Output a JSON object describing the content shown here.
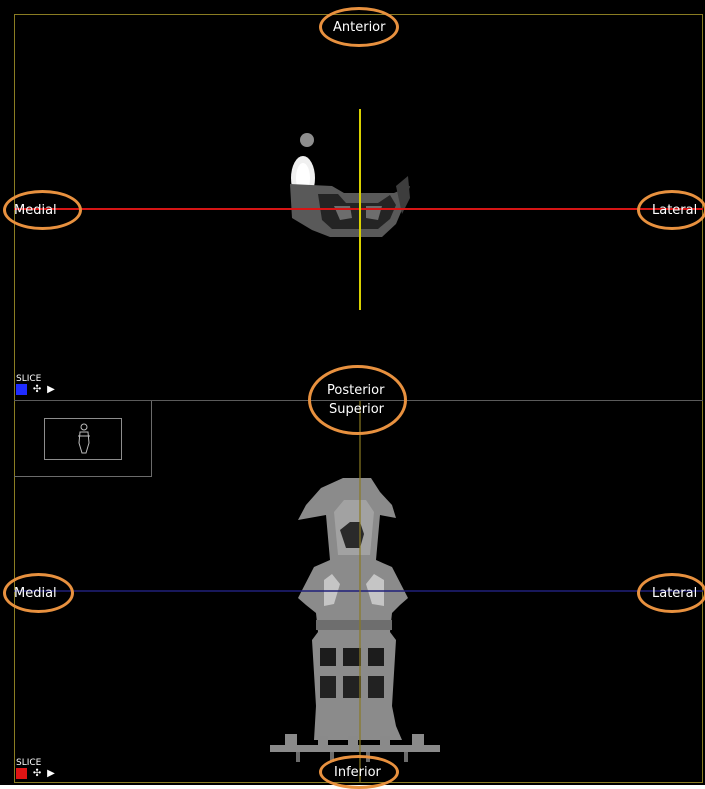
{
  "views": {
    "axial": {
      "top_label": "Anterior",
      "bottom_label": "Posterior",
      "left_label": "Medial",
      "right_label": "Lateral",
      "slice_text": "SLICE",
      "slice_color": "#1f2cff",
      "horizontal_line_color": "#d61515",
      "vertical_line_color": "#d9d100"
    },
    "coronal": {
      "top_label": "Superior",
      "bottom_label": "Inferior",
      "left_label": "Medial",
      "right_label": "Lateral",
      "slice_text": "SLICE",
      "slice_color": "#e01414",
      "horizontal_line_color": "#20207a",
      "vertical_line_color": "#8a7a22"
    }
  },
  "colors": {
    "annotation_ring": "#e8913f",
    "frame": "#8a7c22",
    "background": "#000000"
  },
  "icons": {
    "pan": "crosshair-move-icon",
    "play": "play-icon"
  }
}
